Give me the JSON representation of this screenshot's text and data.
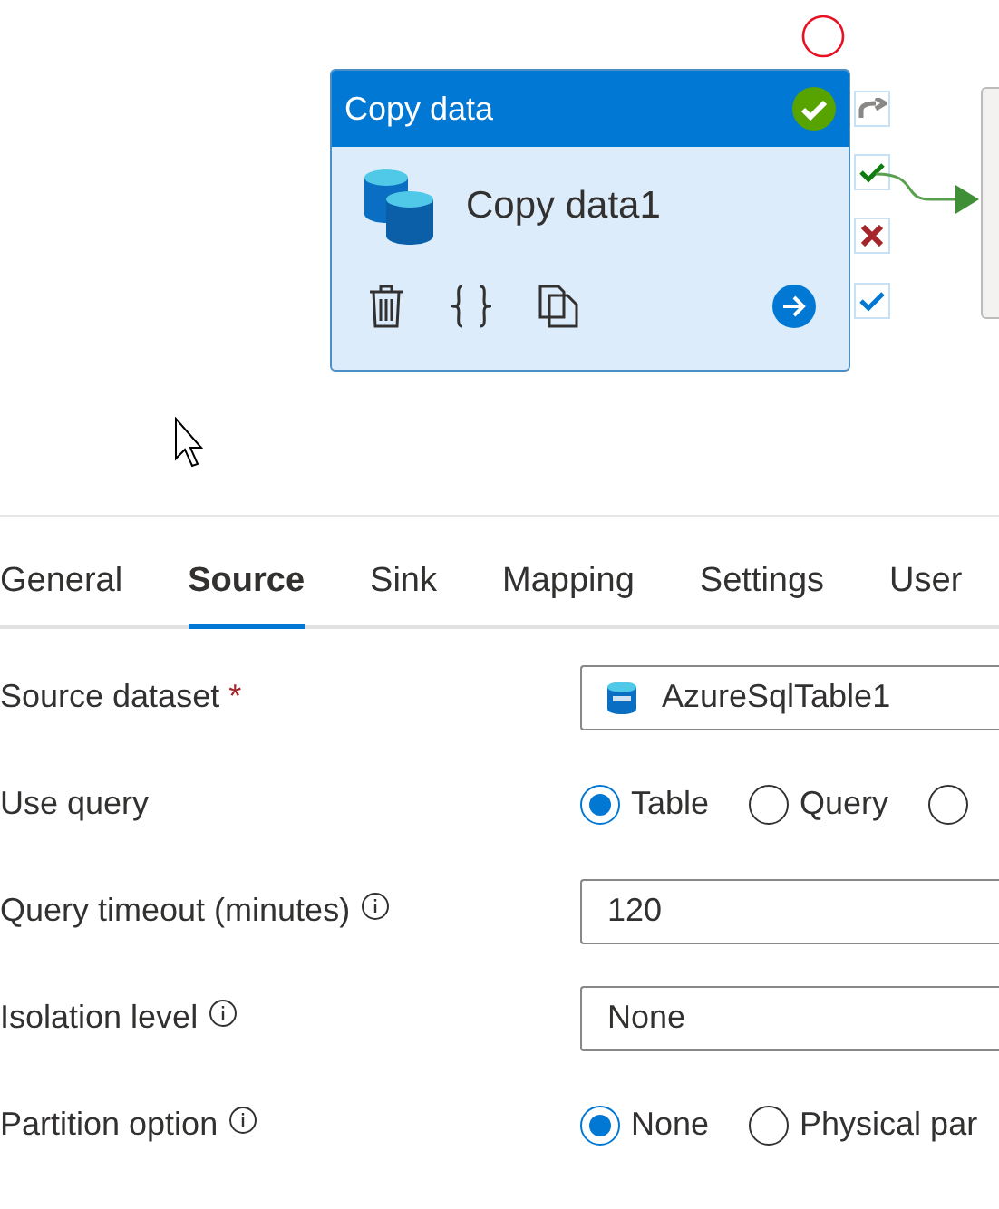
{
  "canvas": {
    "activity": {
      "type": "Copy data",
      "name": "Copy data1",
      "validated": true
    }
  },
  "tabs": [
    {
      "label": "General",
      "selected": false
    },
    {
      "label": "Source",
      "selected": true
    },
    {
      "label": "Sink",
      "selected": false
    },
    {
      "label": "Mapping",
      "selected": false
    },
    {
      "label": "Settings",
      "selected": false
    },
    {
      "label": "User",
      "selected": false
    }
  ],
  "form": [
    {
      "kind": "dataset",
      "label": "Source dataset",
      "required_mark": "*",
      "info": false,
      "value": "AzureSqlTable1"
    },
    {
      "kind": "radio",
      "label": "Use query",
      "info": false,
      "options": [
        {
          "label": "Table",
          "selected": true
        },
        {
          "label": "Query",
          "selected": false
        },
        {
          "selected": false
        }
      ]
    },
    {
      "kind": "input",
      "label": "Query timeout (minutes)",
      "info": true,
      "value": "120"
    },
    {
      "kind": "input",
      "label": "Isolation level",
      "info": true,
      "value": "None"
    },
    {
      "kind": "radio",
      "label": "Partition option",
      "info": true,
      "options": [
        {
          "label": "None",
          "selected": true
        },
        {
          "label": "Physical par",
          "selected": false
        }
      ]
    }
  ]
}
